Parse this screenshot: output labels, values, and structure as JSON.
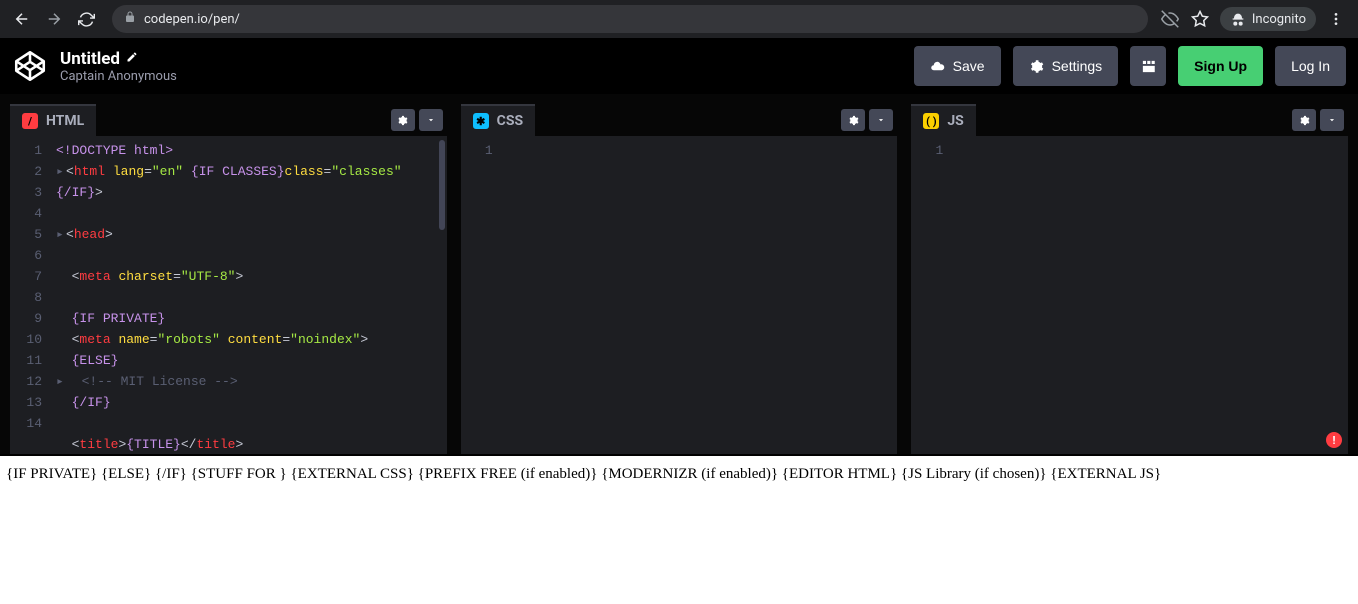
{
  "browser": {
    "url": "codepen.io/pen/",
    "incognito_label": "Incognito"
  },
  "header": {
    "title": "Untitled",
    "author": "Captain Anonymous",
    "buttons": {
      "save": "Save",
      "settings": "Settings",
      "signup": "Sign Up",
      "login": "Log In"
    }
  },
  "editors": {
    "html": {
      "label": "HTML",
      "lines": [
        "1",
        "2",
        "",
        "3",
        "4",
        "5",
        "6",
        "7",
        "8",
        "9",
        "10",
        "11",
        "12",
        "13",
        "14"
      ]
    },
    "css": {
      "label": "CSS",
      "lines": [
        "1"
      ]
    },
    "js": {
      "label": "JS",
      "lines": [
        "1"
      ]
    }
  },
  "code": {
    "l1_a": "<!DOCTYPE html>",
    "l2_lang": "\"en\"",
    "l2_classes": "\"classes\"",
    "l6_charset": "\"UTF-8\"",
    "l9_name": "\"robots\"",
    "l9_content": "\"noindex\"",
    "if_private": "{IF PRIVATE}",
    "else": "{ELSE}",
    "endif": "{/IF}",
    "if_classes_open": "{IF CLASSES}",
    "if_close": "{/IF}",
    "mit": "<!-- MIT License -->",
    "title_ph": "{TITLE}"
  },
  "output_text": "{IF PRIVATE} {ELSE} {/IF} {STUFF FOR } {EXTERNAL CSS} {PREFIX FREE (if enabled)} {MODERNIZR (if enabled)} {EDITOR HTML} {JS Library (if chosen)} {EXTERNAL JS}"
}
